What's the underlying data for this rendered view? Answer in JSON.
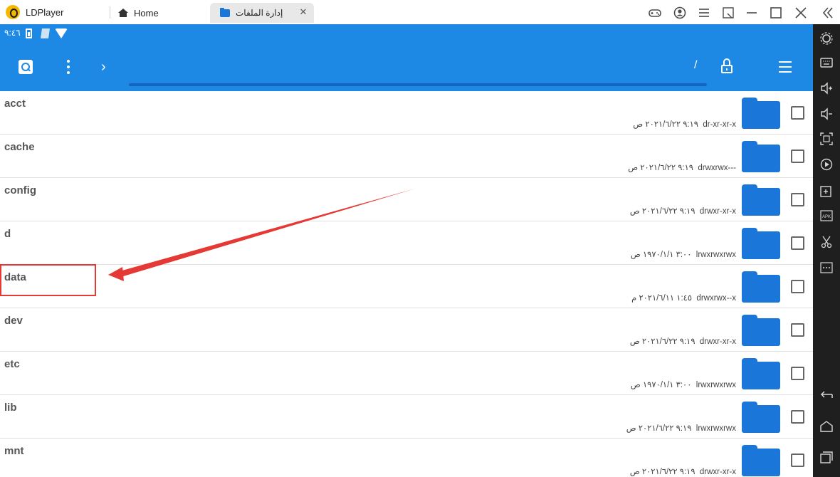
{
  "titlebar": {
    "app_name": "LDPlayer",
    "tabs": [
      {
        "label": "Home"
      },
      {
        "label": "إدارة الملفات"
      }
    ],
    "close_glyph": "✕"
  },
  "statusbar": {
    "time": "٩:٤٦"
  },
  "toolbar": {
    "path": "/",
    "chevron": "›"
  },
  "files": [
    {
      "name": "acct",
      "date": "٢٠٢١/٦/٢٢",
      "time": "٩:١٩ ص",
      "perms": "dr-xr-xr-x"
    },
    {
      "name": "cache",
      "date": "٢٠٢١/٦/٢٢",
      "time": "٩:١٩ ص",
      "perms": "drwxrwx---"
    },
    {
      "name": "config",
      "date": "٢٠٢١/٦/٢٢",
      "time": "٩:١٩ ص",
      "perms": "drwxr-xr-x"
    },
    {
      "name": "d",
      "date": "١٩٧٠/١/١",
      "time": "٣:٠٠ ص",
      "perms": "lrwxrwxrwx"
    },
    {
      "name": "data",
      "date": "٢٠٢١/٦/١١",
      "time": "١:٤٥ م",
      "perms": "drwxrwx--x"
    },
    {
      "name": "dev",
      "date": "٢٠٢١/٦/٢٢",
      "time": "٩:١٩ ص",
      "perms": "drwxr-xr-x"
    },
    {
      "name": "etc",
      "date": "١٩٧٠/١/١",
      "time": "٣:٠٠ ص",
      "perms": "lrwxrwxrwx"
    },
    {
      "name": "lib",
      "date": "٢٠٢١/٦/٢٢",
      "time": "٩:١٩ ص",
      "perms": "lrwxrwxrwx"
    },
    {
      "name": "mnt",
      "date": "٢٠٢١/٦/٢٢",
      "time": "٩:١٩ ص",
      "perms": "drwxr-xr-x"
    }
  ],
  "colors": {
    "accent": "#1e88e5",
    "folder": "#1a77d9",
    "annotation": "#e53935",
    "sidebar": "#1f1f1f"
  },
  "icons": {
    "titlebar": [
      "gamepad-icon",
      "account-icon",
      "menu-icon",
      "restore-icon",
      "minimize-icon",
      "maximize-icon",
      "close-icon",
      "collapse-icon"
    ],
    "sidebar": [
      "settings-icon",
      "keyboard-icon",
      "volume-up-icon",
      "volume-down-icon",
      "fullscreen-icon",
      "record-icon",
      "add-app-icon",
      "apk-icon",
      "cut-icon",
      "more-icon",
      "back-icon",
      "home-icon",
      "recent-apps-icon"
    ]
  }
}
